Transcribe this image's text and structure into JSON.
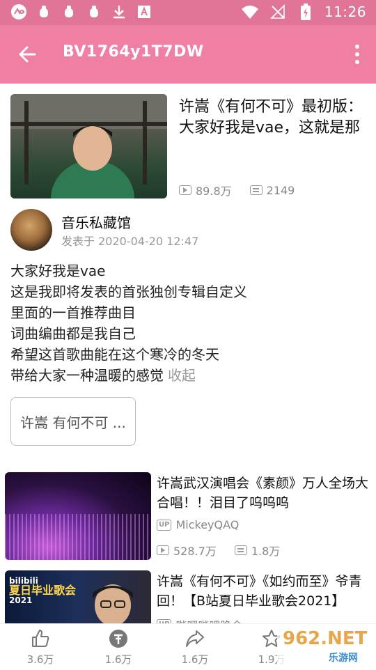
{
  "status_bar": {
    "time": "11:26",
    "icons": [
      "app-logo-icon",
      "bug-icon",
      "bug-icon",
      "bug-icon",
      "download-icon",
      "font-a-icon",
      "wifi-icon",
      "no-signal-icon",
      "battery-charging-icon"
    ]
  },
  "app_bar": {
    "title": "BV1764y1T7DW",
    "accent_color": "#f07fa4"
  },
  "main_video": {
    "title": "许嵩《有何不可》最初版：大家好我是vae，这就是那首歌",
    "views": "89.8万",
    "danmaku": "2149"
  },
  "uploader": {
    "name": "音乐私藏馆",
    "posted": "发表于 2020-04-20 12:47"
  },
  "description": {
    "lines": [
      "大家好我是vae",
      "这是我即将发表的首张独创专辑自定义",
      "里面的一首推荐曲目",
      "词曲编曲都是我自己",
      "希望这首歌曲能在这个寒冷的冬天",
      "带给大家一种温暖的感觉"
    ],
    "collapse_label": "收起"
  },
  "tag": {
    "label": "许嵩 有何不可 ..."
  },
  "related": [
    {
      "title": "许嵩武汉演唱会《素颜》万人全场大合唱！！泪目了呜呜呜",
      "up_badge": "UP",
      "uploader": "MickeyQAQ",
      "views": "528.7万",
      "danmaku": "1.8万"
    },
    {
      "title": "许嵩《有何不可》《如约而至》爷青回！【B站夏日毕业歌会2021】",
      "up_badge": "UP",
      "uploader": "哔哩哔哩晚会",
      "thumb_text_top": "bilibili",
      "thumb_text_main": "夏日毕业歌会",
      "thumb_text_year": "2021"
    }
  ],
  "bottom_bar": {
    "like": "3.6万",
    "coin": "1.6万",
    "share": "1.6万",
    "favorite": "1.9万"
  },
  "watermark": {
    "main": "962.NET",
    "sub": "乐游网"
  }
}
